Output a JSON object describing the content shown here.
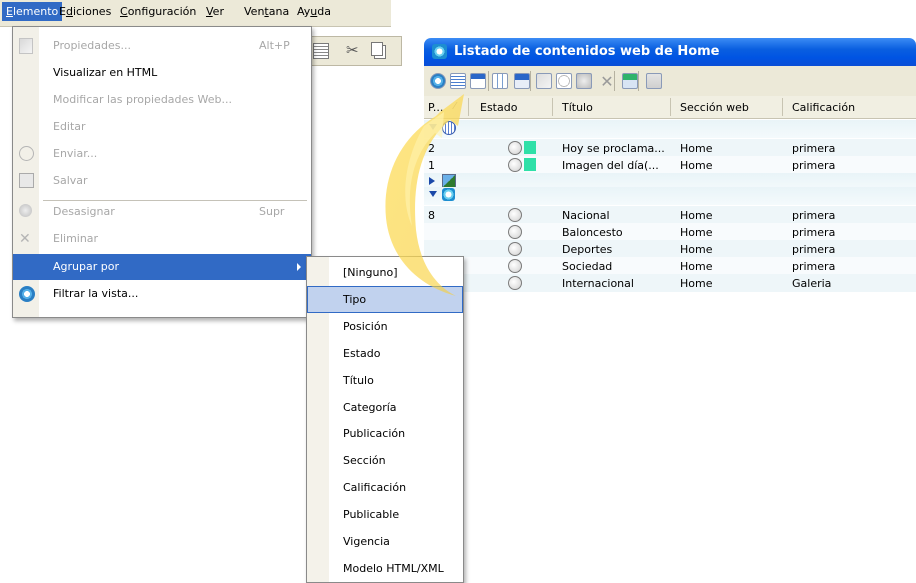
{
  "menubar": {
    "items": [
      {
        "pre": "",
        "u": "E",
        "post": "lemento"
      },
      {
        "pre": "E",
        "u": "d",
        "post": "iciones"
      },
      {
        "pre": "",
        "u": "C",
        "post": "onfiguración"
      },
      {
        "pre": "",
        "u": "V",
        "post": "er"
      },
      {
        "pre": "Ven",
        "u": "t",
        "post": "ana"
      },
      {
        "pre": "Ay",
        "u": "u",
        "post": "da"
      }
    ]
  },
  "menu": {
    "items": [
      {
        "label": "Propiedades...",
        "shortcut": "Alt+P",
        "icon": "pencil-page-icon",
        "disabled": true
      },
      {
        "label": "Visualizar en HTML",
        "shortcut": "",
        "icon": "",
        "disabled": false
      },
      {
        "label": "Modificar las propiedades Web...",
        "shortcut": "",
        "icon": "",
        "disabled": true
      },
      {
        "label": "Editar",
        "shortcut": "",
        "icon": "",
        "disabled": true
      },
      {
        "label": "Enviar...",
        "shortcut": "",
        "icon": "send-icon",
        "disabled": true
      },
      {
        "label": "Salvar",
        "shortcut": "",
        "icon": "save-icon",
        "disabled": true
      },
      {
        "label": "Desasignar",
        "shortcut": "Supr",
        "icon": "unassign-icon",
        "disabled": true
      },
      {
        "label": "Eliminar",
        "shortcut": "",
        "icon": "delete-x-icon",
        "disabled": true
      },
      {
        "label": "Agrupar por",
        "shortcut": "",
        "icon": "",
        "disabled": false
      },
      {
        "label": "Filtrar la vista...",
        "shortcut": "",
        "icon": "filter-icon",
        "disabled": false
      }
    ]
  },
  "submenu": {
    "items": [
      "[Ninguno]",
      "Tipo",
      "Posición",
      "Estado",
      "Título",
      "Categoría",
      "Publicación",
      "Sección",
      "Calificación",
      "Publicable",
      "Vigencia",
      "Modelo HTML/XML"
    ],
    "highlighted": 1
  },
  "window": {
    "title": "Listado de contenidos web de Home",
    "columns": [
      "P...",
      "Estado",
      "Título",
      "Sección web",
      "Calificación"
    ],
    "groups": [
      {
        "open": true,
        "icon": "globe-icon",
        "rows": [
          {
            "p": "2",
            "status_green": true,
            "titulo": "Hoy se proclama...",
            "seccion": "Home",
            "calif": "primera"
          },
          {
            "p": "1",
            "status_green": true,
            "titulo": "Imagen del día(...",
            "seccion": "Home",
            "calif": "primera"
          }
        ]
      },
      {
        "open": false,
        "icon": "image-icon",
        "rows": []
      },
      {
        "open": true,
        "icon": "web-page-icon",
        "rows": [
          {
            "p": "8",
            "status_green": false,
            "titulo": "Nacional",
            "seccion": "Home",
            "calif": "primera"
          },
          {
            "p": "",
            "status_green": false,
            "titulo": "Baloncesto",
            "seccion": "Home",
            "calif": "primera"
          },
          {
            "p": "",
            "status_green": false,
            "titulo": "Deportes",
            "seccion": "Home",
            "calif": "primera"
          },
          {
            "p": "",
            "status_green": false,
            "titulo": "Sociedad",
            "seccion": "Home",
            "calif": "primera"
          },
          {
            "p": "",
            "status_green": false,
            "titulo": "Internacional",
            "seccion": "Home",
            "calif": "Galeria"
          }
        ]
      }
    ]
  },
  "colors": {
    "accent": "#316ac5",
    "title_bar": "#0054e3",
    "status_green": "#2fe0a8"
  }
}
